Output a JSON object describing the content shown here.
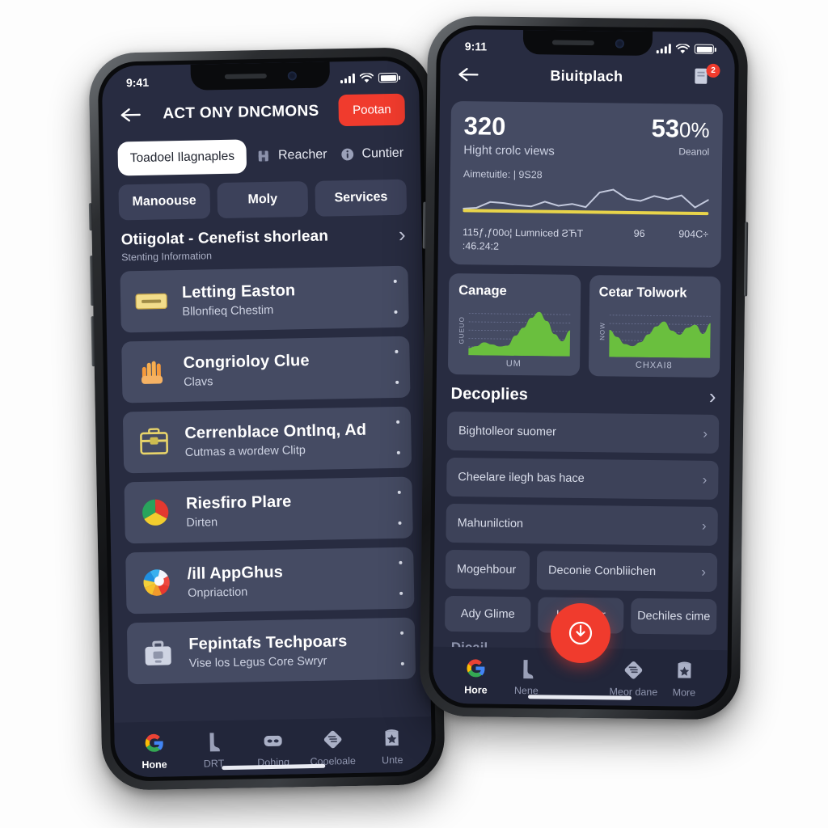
{
  "left_phone": {
    "status": {
      "time": "9:41",
      "signal_icon": "signal-bars-icon",
      "wifi_icon": "wifi-icon",
      "battery_icon": "battery-icon"
    },
    "appbar": {
      "back_icon": "back-arrow-icon",
      "title": "ACT ONY DNCMONS",
      "action_label": "Pootan"
    },
    "segments": [
      {
        "label": "Toadoel Ilagnaples",
        "selected": true,
        "icon": ""
      },
      {
        "label": "Reacher",
        "selected": false,
        "icon": "film-icon"
      },
      {
        "label": "Cuntier",
        "selected": false,
        "icon": "info-icon"
      }
    ],
    "chips": [
      "Manoouse",
      "Moly",
      "Services"
    ],
    "section": {
      "title": "Otiigolat - Cenefist shorlean",
      "subtitle": "Stenting Information",
      "chevron_icon": "chevron-right-icon"
    },
    "items": [
      {
        "title": "Letting Easton",
        "subtitle": "Bllonfieq Chestim",
        "icon": "yellow-badge-icon"
      },
      {
        "title": "Congrioloy Clue",
        "subtitle": "Clavs",
        "icon": "orange-hand-icon"
      },
      {
        "title": "Cerrenblace Ontlnq, Ad",
        "subtitle": "Cutmas a wordew Clitp",
        "icon": "yellow-toolbox-icon"
      },
      {
        "title": "Riesfiro Plare",
        "subtitle": "Dirten",
        "icon": "pie-chart-icon"
      },
      {
        "title": "/ill AppGhus",
        "subtitle": "Onpriaction",
        "icon": "color-wheel-icon"
      },
      {
        "title": "Fepintafs Techpoars",
        "subtitle": "Vise los Legus Core Swryr",
        "icon": "grey-toolbox-icon"
      }
    ],
    "tabs": [
      {
        "label": "Hone",
        "icon": "google-g-icon",
        "active": true
      },
      {
        "label": "DRT",
        "icon": "boot-icon",
        "active": false
      },
      {
        "label": "Dohing",
        "icon": "robot-icon",
        "active": false
      },
      {
        "label": "Cooeloale",
        "icon": "diamond-note-icon",
        "active": false
      },
      {
        "label": "Unte",
        "icon": "star-shield-icon",
        "active": false
      }
    ]
  },
  "right_phone": {
    "status": {
      "time": "9:11",
      "signal_icon": "signal-bars-icon",
      "wifi_icon": "wifi-icon",
      "battery_icon": "battery-icon"
    },
    "appbar": {
      "back_icon": "back-arrow-icon",
      "title": "Biuitplach",
      "notify_icon": "document-bell-icon",
      "badge": "2"
    },
    "stat": {
      "big_value": "320",
      "big_label": "Hight crolc views",
      "pct_value": "53",
      "pct_unit": "0%",
      "pct_label": "Deanol",
      "meta": "Aimetuitle: | 9S28",
      "foot_left": "115ƒ,ƒ00o¦ Lumniced ƧЋT :46.24:2",
      "foot_mid": "96",
      "foot_right": "904C÷"
    },
    "mini_cards": [
      {
        "title": "Canage",
        "ylabel": "GUEUO",
        "xlabel": "UM"
      },
      {
        "title": "Cetar Tolwork",
        "ylabel": "NOW",
        "xlabel": "CHXAI8"
      }
    ],
    "section": {
      "title": "Decoplies",
      "chevron_icon": "chevron-right-icon"
    },
    "rows": [
      "Bightolleor suomer",
      "Cheelare ilegh bas hace",
      "Mahunilction"
    ],
    "split_rows": [
      {
        "label": "Mogehbour",
        "chevron": false
      },
      {
        "label": "Deconie Conbliichen",
        "chevron": true
      }
    ],
    "tag_rows": [
      "Ady Glime",
      "Inteorgier",
      "Dechiles cime"
    ],
    "diag_label": "Dicail",
    "fab_icon": "power-clock-icon",
    "tabs": [
      {
        "label": "Hore",
        "icon": "google-g-icon",
        "active": true
      },
      {
        "label": "Nene",
        "icon": "boot-icon",
        "active": false
      },
      {
        "label": "Meor dane",
        "icon": "diamond-note-icon",
        "active": false
      },
      {
        "label": "More",
        "icon": "star-shield-icon",
        "active": false
      }
    ]
  },
  "chart_data": [
    {
      "type": "line",
      "title": "Aimetuitle: | 9S28",
      "x": [
        0,
        1,
        2,
        3,
        4,
        5,
        6,
        7,
        8,
        9,
        10,
        11,
        12,
        13,
        14,
        15,
        16,
        17,
        18
      ],
      "series": [
        {
          "name": "trend",
          "color": "#c3c9dd",
          "values": [
            10,
            11,
            17,
            16,
            14,
            13,
            18,
            14,
            16,
            13,
            28,
            31,
            22,
            20,
            25,
            22,
            26,
            14,
            22
          ]
        },
        {
          "name": "baseline",
          "color": "#e8d44a",
          "values": [
            8,
            8,
            8,
            8,
            8,
            8,
            8,
            8,
            8,
            8,
            8,
            8,
            8,
            8,
            8,
            8,
            8,
            8,
            8
          ]
        }
      ],
      "ylim": [
        0,
        36
      ],
      "grid": false,
      "legend": "none"
    },
    {
      "type": "area",
      "title": "Canage",
      "xlabel": "UM",
      "ylabel": "GUEUO",
      "x": [
        0,
        1,
        2,
        3,
        4,
        5,
        6,
        7,
        8,
        9,
        10,
        11,
        12,
        13
      ],
      "values": [
        14,
        18,
        26,
        22,
        18,
        20,
        40,
        56,
        76,
        88,
        70,
        44,
        30,
        52
      ],
      "color": "#6abf3e",
      "ylim": [
        0,
        100
      ],
      "grid": true
    },
    {
      "type": "area",
      "title": "Cetar Tolwork",
      "xlabel": "CHXAI8",
      "ylabel": "NOW",
      "x": [
        0,
        1,
        2,
        3,
        4,
        5,
        6,
        7,
        8,
        9,
        10,
        11,
        12,
        13
      ],
      "values": [
        54,
        40,
        26,
        22,
        30,
        46,
        62,
        72,
        54,
        46,
        60,
        66,
        48,
        70
      ],
      "color": "#6abf3e",
      "ylim": [
        0,
        100
      ],
      "grid": true
    }
  ],
  "colors": {
    "accent_red": "#f03b2d",
    "screen_bg": "#282c41",
    "card_bg": "#454b63",
    "chart_green": "#6abf3e",
    "chart_yellow": "#e8d44a",
    "tabbar_bg": "#22263a"
  }
}
